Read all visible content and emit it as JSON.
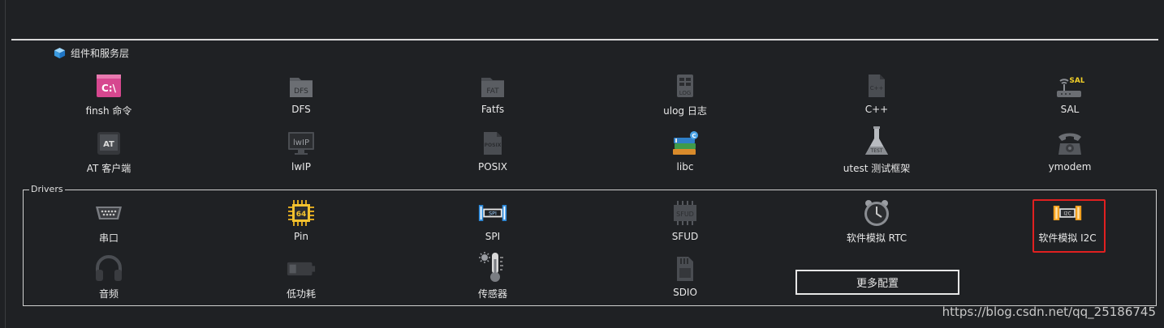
{
  "section": {
    "title": "组件和服务层",
    "icon": "cube-icon"
  },
  "components": [
    {
      "label": "finsh 命令",
      "icon": "terminal-icon"
    },
    {
      "label": "DFS",
      "icon": "dfs-folder-icon"
    },
    {
      "label": "Fatfs",
      "icon": "fat-folder-icon"
    },
    {
      "label": "ulog 日志",
      "icon": "log-icon"
    },
    {
      "label": "C++",
      "icon": "cpp-file-icon"
    },
    {
      "label": "SAL",
      "icon": "router-icon"
    },
    {
      "label": "AT 客户端",
      "icon": "at-icon"
    },
    {
      "label": "lwIP",
      "icon": "monitor-icon"
    },
    {
      "label": "POSIX",
      "icon": "posix-file-icon"
    },
    {
      "label": "libc",
      "icon": "books-icon"
    },
    {
      "label": "utest 测试框架",
      "icon": "flask-icon"
    },
    {
      "label": "ymodem",
      "icon": "telephone-icon"
    }
  ],
  "drivers": {
    "title": "Drivers",
    "items": [
      {
        "label": "串口",
        "icon": "serial-port-icon"
      },
      {
        "label": "Pin",
        "icon": "chip-icon"
      },
      {
        "label": "SPI",
        "icon": "spi-icon"
      },
      {
        "label": "SFUD",
        "icon": "sfud-chip-icon"
      },
      {
        "label": "软件模拟 RTC",
        "icon": "clock-icon"
      },
      {
        "label": "软件模拟 I2C",
        "icon": "i2c-icon"
      },
      {
        "label": "音频",
        "icon": "headphones-icon"
      },
      {
        "label": "低功耗",
        "icon": "battery-icon"
      },
      {
        "label": "传感器",
        "icon": "thermometer-icon"
      },
      {
        "label": "SDIO",
        "icon": "sd-card-icon"
      }
    ],
    "more_button": "更多配置"
  },
  "watermark": "https://blog.csdn.net/qq_25186745",
  "colors": {
    "background": "#1f2124",
    "highlight": "#e02020",
    "accent_pink": "#d6478f"
  }
}
